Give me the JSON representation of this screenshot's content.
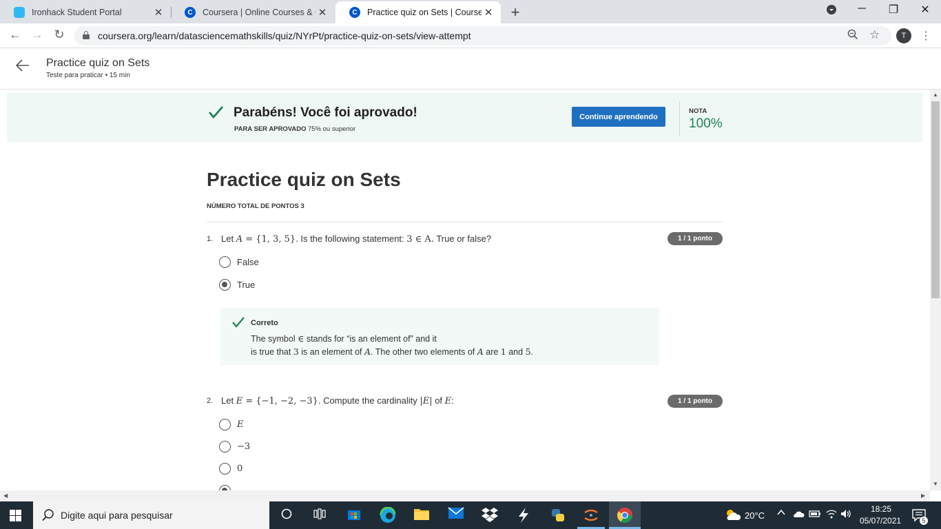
{
  "browser": {
    "tabs": [
      {
        "title": "Ironhack Student Portal",
        "favicon": "ironhack-icon",
        "active": false
      },
      {
        "title": "Coursera | Online Courses & Cred",
        "favicon": "coursera-icon",
        "active": false
      },
      {
        "title": "Practice quiz on Sets | Coursera",
        "favicon": "coursera-icon",
        "active": true
      }
    ],
    "url": "coursera.org/learn/datasciencemathskills/quiz/NYrPt/practice-quiz-on-sets/view-attempt",
    "profile_initial": "T"
  },
  "header": {
    "title": "Practice quiz on Sets",
    "subtitle": "Teste para praticar • 15 min"
  },
  "banner": {
    "title": "Parabéns! Você foi aprovado!",
    "pass_label": "PARA SER APROVADO",
    "pass_value": "75% ou superior",
    "continue_label": "Continue aprendendo",
    "grade_label": "NOTA",
    "grade_value": "100%",
    "grade_color": "#1f8354",
    "button_color": "#1f70c1"
  },
  "quiz": {
    "title": "Practice quiz on Sets",
    "total_points": "NÚMERO TOTAL DE PONTOS 3",
    "questions": [
      {
        "number": "1.",
        "parts": [
          "Let ",
          "A",
          " = {1, 3, 5}",
          ". Is the following statement: ",
          "3 ∈ A.",
          " True or false?"
        ],
        "points": "1 / 1 ponto",
        "options": [
          {
            "label": "False",
            "selected": false
          },
          {
            "label": "True",
            "selected": true
          }
        ],
        "feedback": {
          "title": "Correto",
          "line1": [
            "The symbol ",
            "∈",
            " stands for “is an element of” and it"
          ],
          "line2": [
            "is true that ",
            "3",
            " is an element of ",
            "A",
            ". The other two elements of ",
            "A",
            " are ",
            "1",
            " and ",
            "5",
            "."
          ]
        }
      },
      {
        "number": "2.",
        "parts": [
          "Let ",
          "E",
          " = {−1, −2, −3}",
          ". Compute the cardinality ",
          "|E|",
          " of ",
          "E",
          ":"
        ],
        "points": "1 / 1 ponto",
        "options": [
          {
            "label": "E",
            "selected": false
          },
          {
            "label": "−3",
            "selected": false
          },
          {
            "label": "0",
            "selected": false
          }
        ]
      }
    ]
  },
  "taskbar": {
    "search_placeholder": "Digite aqui para pesquisar",
    "weather": "20°C",
    "time": "18:25",
    "date": "05/07/2021",
    "notification_count": "5"
  }
}
